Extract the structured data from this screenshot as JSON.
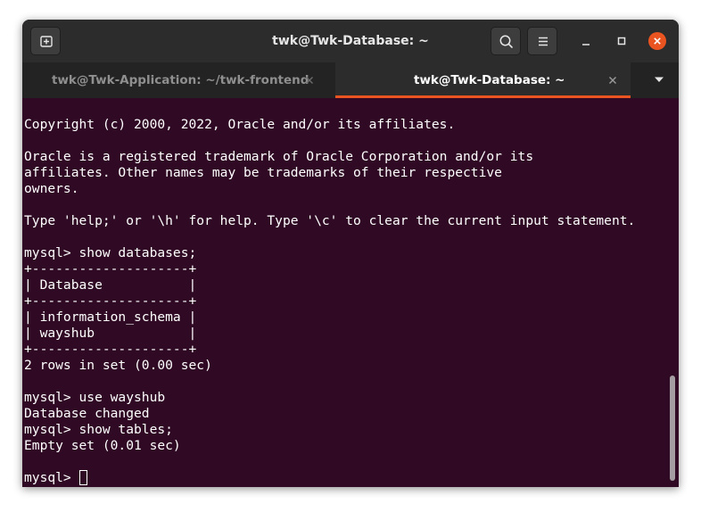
{
  "window": {
    "title": "twk@Twk-Database: ~"
  },
  "tabs": [
    {
      "label": "twk@Twk-Application: ~/twk-frontend",
      "active": false
    },
    {
      "label": "twk@Twk-Database: ~",
      "active": true
    }
  ],
  "icons": {
    "new_tab": "new-tab-icon",
    "search": "search-icon",
    "menu": "hamburger-menu-icon",
    "minimize": "minimize-icon",
    "maximize": "maximize-icon",
    "close": "close-icon",
    "tab_close": "tab-close-icon",
    "tab_dropdown": "chevron-down-icon"
  },
  "colors": {
    "terminal_bg": "#300a24",
    "accent": "#e95420",
    "titlebar_bg": "#2c2c2c",
    "text": "#ffffff"
  },
  "terminal": {
    "lines": [
      "Copyright (c) 2000, 2022, Oracle and/or its affiliates.",
      "",
      "Oracle is a registered trademark of Oracle Corporation and/or its",
      "affiliates. Other names may be trademarks of their respective",
      "owners.",
      "",
      "Type 'help;' or '\\h' for help. Type '\\c' to clear the current input statement.",
      "",
      "mysql> show databases;",
      "+--------------------+",
      "| Database           |",
      "+--------------------+",
      "| information_schema |",
      "| wayshub            |",
      "+--------------------+",
      "2 rows in set (0.00 sec)",
      "",
      "mysql> use wayshub",
      "Database changed",
      "mysql> show tables;",
      "Empty set (0.01 sec)",
      ""
    ],
    "prompt": "mysql> "
  }
}
